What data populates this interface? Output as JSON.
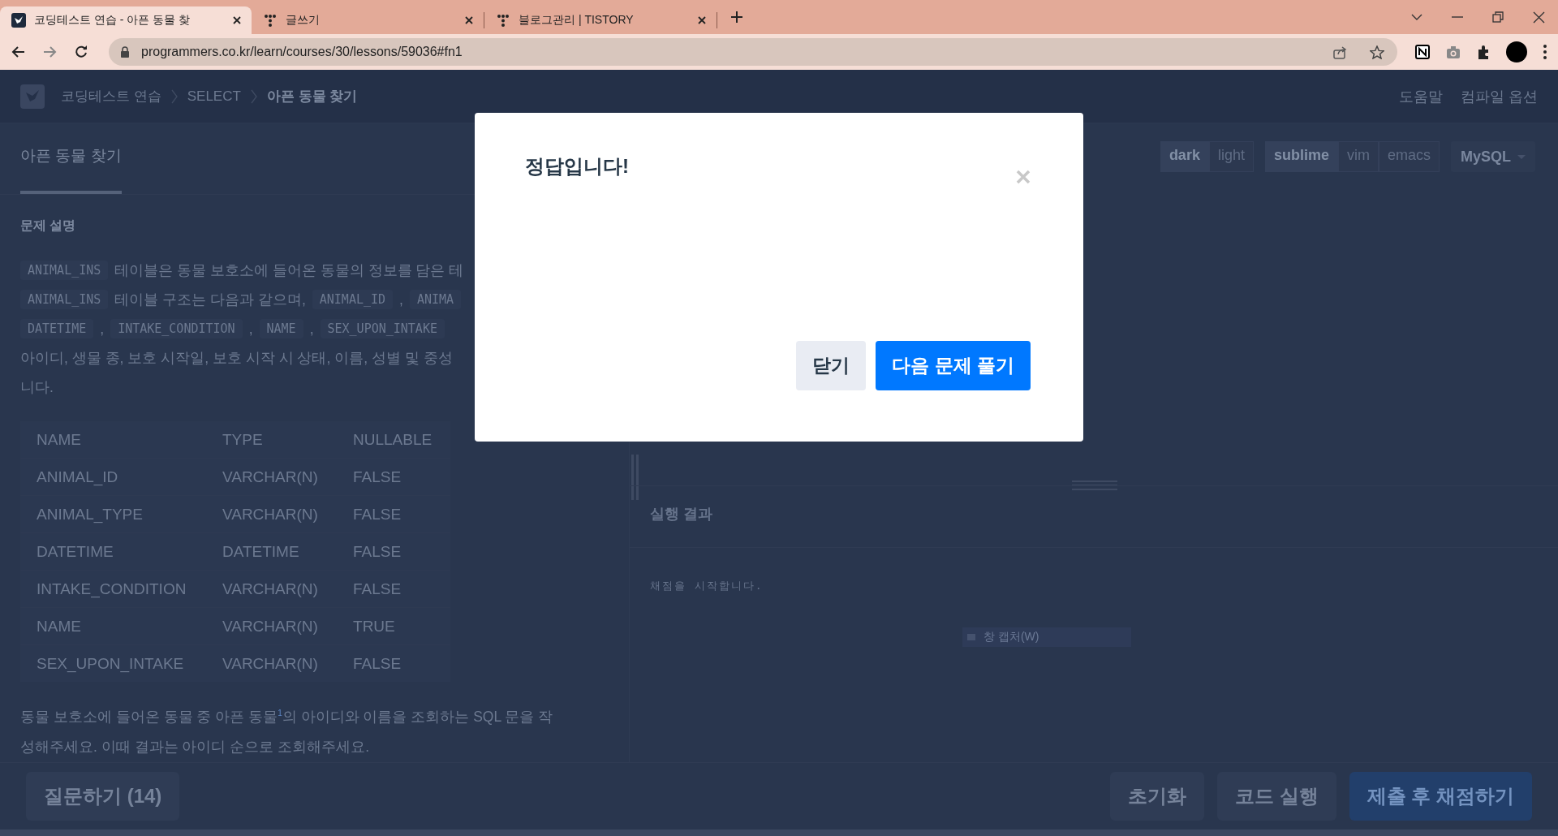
{
  "browser": {
    "tabs": [
      {
        "title": "코딩테스트 연습 - 아픈 동물 찾",
        "selected": true,
        "kind": "programmers"
      },
      {
        "title": "글쓰기",
        "selected": false,
        "kind": "tistory"
      },
      {
        "title": "블로그관리 | TISTORY",
        "selected": false,
        "kind": "tistory"
      }
    ],
    "url": "programmers.co.kr/learn/courses/30/lessons/59036#fn1"
  },
  "header": {
    "breadcrumbs": [
      "코딩테스트 연습",
      "SELECT",
      "아픈 동물 찾기"
    ],
    "links": [
      "도움말",
      "컴파일 옵션"
    ]
  },
  "problem_tabs": [
    {
      "label": "아픈 동물 찾기",
      "selected": true
    }
  ],
  "section_title": "문제 설명",
  "description_lines": [
    [
      {
        "kind": "code",
        "text": "ANIMAL_INS"
      },
      {
        "kind": "text",
        "text": "테이블은 동물 보호소에 들어온 동물의 정보를 담은 테"
      }
    ],
    [
      {
        "kind": "code",
        "text": "ANIMAL_INS"
      },
      {
        "kind": "text",
        "text": "테이블 구조는 다음과 같으며,"
      },
      {
        "kind": "code",
        "text": "ANIMAL_ID"
      },
      {
        "kind": "text",
        "text": ","
      },
      {
        "kind": "code",
        "text": "ANIMA"
      }
    ],
    [
      {
        "kind": "code",
        "text": "DATETIME"
      },
      {
        "kind": "text",
        "text": ","
      },
      {
        "kind": "code",
        "text": "INTAKE_CONDITION"
      },
      {
        "kind": "text",
        "text": ","
      },
      {
        "kind": "code",
        "text": "NAME"
      },
      {
        "kind": "text",
        "text": ","
      },
      {
        "kind": "code",
        "text": "SEX_UPON_INTAKE"
      }
    ],
    [
      {
        "kind": "text",
        "text": "아이디, 생물 종, 보호 시작일, 보호 시작 시 상태, 이름, 성별 및 중성"
      }
    ],
    [
      {
        "kind": "text",
        "text": "니다."
      }
    ]
  ],
  "schema_table": {
    "columns": [
      "NAME",
      "TYPE",
      "NULLABLE"
    ],
    "rows": [
      [
        "ANIMAL_ID",
        "VARCHAR(N)",
        "FALSE"
      ],
      [
        "ANIMAL_TYPE",
        "VARCHAR(N)",
        "FALSE"
      ],
      [
        "DATETIME",
        "DATETIME",
        "FALSE"
      ],
      [
        "INTAKE_CONDITION",
        "VARCHAR(N)",
        "FALSE"
      ],
      [
        "NAME",
        "VARCHAR(N)",
        "TRUE"
      ],
      [
        "SEX_UPON_INTAKE",
        "VARCHAR(N)",
        "FALSE"
      ]
    ]
  },
  "question": [
    "동물 보호소에 들어온 동물 중 아픈 동물$^{1}$의 아이디와 이름을 조회하는 SQL 문을 작",
    "성해주세요. 이때 결과는 아이디 순으로 조회해주세요."
  ],
  "ask_button": "질문하기 (14)",
  "editor_toolbar": {
    "themes": [
      {
        "label": "dark",
        "selected": true
      },
      {
        "label": "light",
        "selected": false
      }
    ],
    "keymaps": [
      {
        "label": "sublime",
        "selected": true
      },
      {
        "label": "vim",
        "selected": false
      },
      {
        "label": "emacs",
        "selected": false
      }
    ],
    "language": "MySQL"
  },
  "result": {
    "title": "실행 결과",
    "output": "채점을 시작합니다.",
    "tooltip": "창 캡처(W)"
  },
  "actions": [
    {
      "label": "초기화",
      "kind": "secondary"
    },
    {
      "label": "코드 실행",
      "kind": "secondary"
    },
    {
      "label": "제출 후 채점하기",
      "kind": "primary"
    }
  ],
  "modal": {
    "title": "정답입니다!",
    "buttons": [
      {
        "label": "닫기",
        "kind": "secondary"
      },
      {
        "label": "다음 문제 풀기",
        "kind": "primary"
      }
    ]
  }
}
